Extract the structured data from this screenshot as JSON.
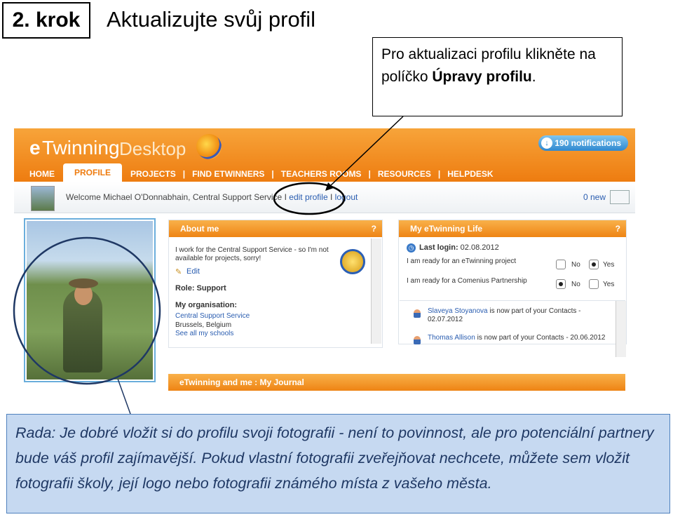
{
  "slide": {
    "step": "2. krok",
    "title": "Aktualizujte svůj profil",
    "callout_pre": "Pro aktualizaci profilu klikněte na políčko ",
    "callout_bold": "Úpravy profilu",
    "callout_post": ".",
    "tip": "Rada: Je dobré vložit si do profilu svoji fotografii - není to povinnost, ale pro potenciální partnery bude váš profil zajímavější. Pokud vlastní fotografii zveřejňovat nechcete, můžete sem vložit fotografii školy, její logo nebo fotografii známého místa z vašeho města."
  },
  "app": {
    "logo_e": "e",
    "logo_twinning": "Twinning",
    "logo_desktop": "Desktop",
    "notifications": "190 notifications",
    "nav": [
      "HOME",
      "PROFILE",
      "PROJECTS",
      "FIND ETWINNERS",
      "TEACHERS ROOMS",
      "RESOURCES",
      "HELPDESK"
    ],
    "nav_separators": [
      "|",
      "|",
      "|",
      "|"
    ],
    "welcome": "Welcome Michael O'Donnabhain, Central Support Service",
    "sep1": "I",
    "edit_profile": "edit profile",
    "sep2": "I",
    "logout": "logout",
    "new_messages": "0 new"
  },
  "about": {
    "title": "About me",
    "help": "?",
    "text": "I work for the Central Support Service - so I'm not available for projects, sorry!",
    "edit": "Edit",
    "role": "Role: Support",
    "org_label": "My organisation:",
    "org_name": "Central Support Service",
    "org_location": "Brussels, Belgium",
    "see_schools": "See all my schools"
  },
  "life": {
    "title": "My eTwinning Life",
    "help": "?",
    "last_login_label": "Last login:",
    "last_login": "02.08.2012",
    "ready_project": "I am ready for an eTwinning project",
    "ready_comenius": "I am ready for a Comenius Partnership",
    "no": "No",
    "yes": "Yes",
    "contacts": [
      {
        "name": "Slaveya Stoyanova",
        "text": " is now part of your Contacts - 02.07.2012"
      },
      {
        "name": "Thomas Allison",
        "text": " is now part of your Contacts - 20.06.2012"
      }
    ]
  },
  "journal": {
    "title": "eTwinning and me : My Journal"
  }
}
